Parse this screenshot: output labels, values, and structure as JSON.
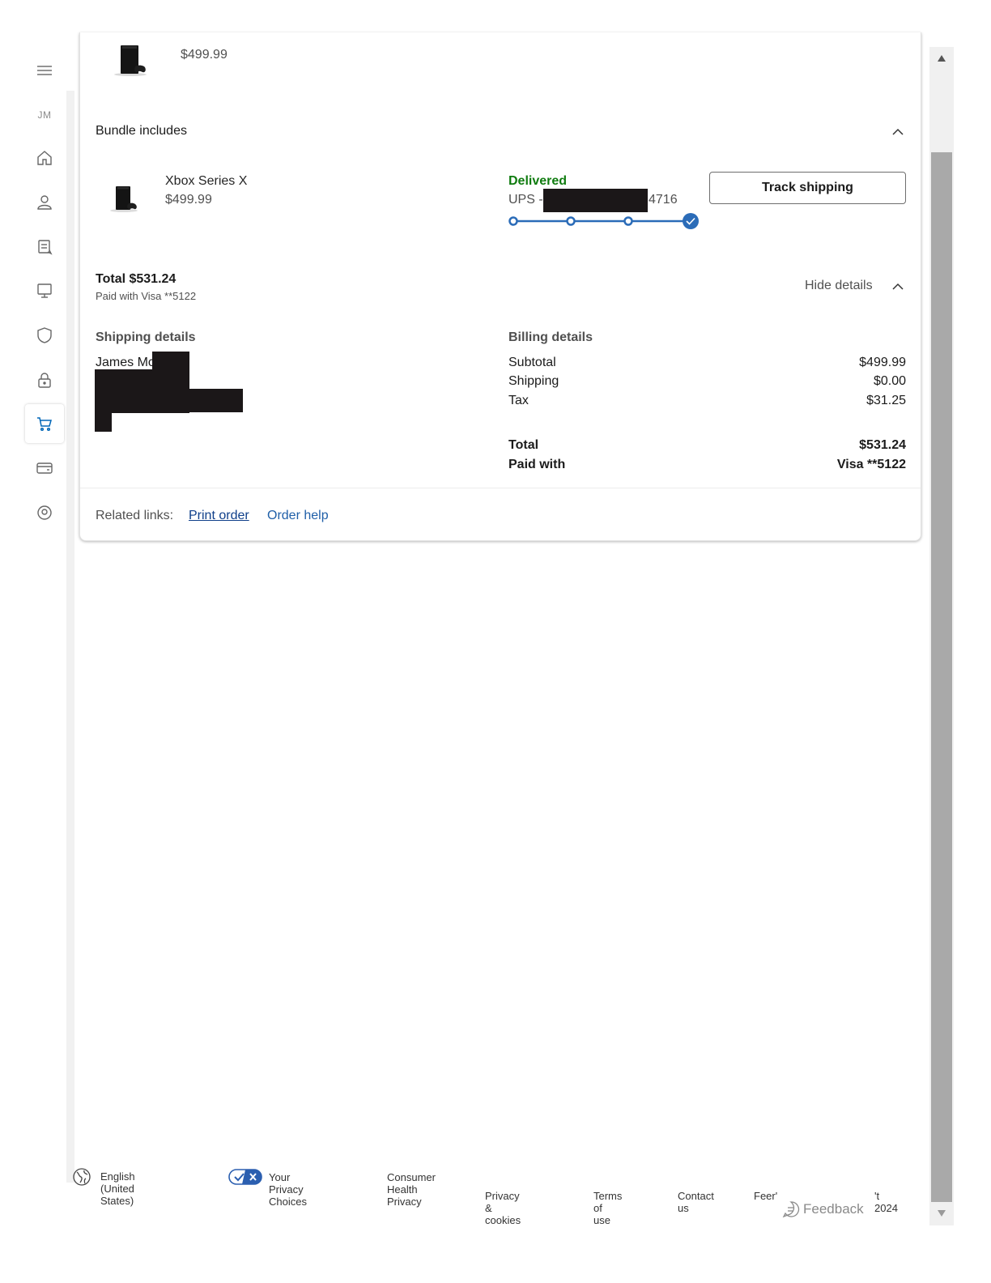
{
  "rail": {
    "menu_icon": "hamburger-icon",
    "initials": "JM",
    "items": [
      {
        "name": "home",
        "icon": "home-icon"
      },
      {
        "name": "profile",
        "icon": "person-icon"
      },
      {
        "name": "rewards",
        "icon": "document-icon"
      },
      {
        "name": "devices",
        "icon": "monitor-icon"
      },
      {
        "name": "security",
        "icon": "shield-icon"
      },
      {
        "name": "privacy",
        "icon": "lock-icon"
      },
      {
        "name": "orders",
        "icon": "cart-icon",
        "active": true
      },
      {
        "name": "payment",
        "icon": "card-icon"
      },
      {
        "name": "addresses",
        "icon": "location-icon"
      }
    ]
  },
  "order": {
    "top_item_price": "$499.99",
    "bundle_heading": "Bundle includes",
    "bundle_item": {
      "name": "Xbox Series X",
      "price": "$499.99",
      "status": "Delivered",
      "carrier_prefix": "UPS -",
      "tracking_suffix": "4716",
      "progress_steps": 4,
      "progress_completed": 4
    },
    "track_button": "Track shipping",
    "total_label": "Total $531.24",
    "paid_with_line": "Paid with Visa **5122",
    "hide_details": "Hide details"
  },
  "shipping": {
    "heading": "Shipping details",
    "name_visible": "James Mc"
  },
  "billing": {
    "heading": "Billing details",
    "rows": [
      {
        "label": "Subtotal",
        "value": "$499.99"
      },
      {
        "label": "Shipping",
        "value": "$0.00"
      },
      {
        "label": "Tax",
        "value": "$31.25"
      }
    ],
    "total_label": "Total",
    "total_value": "$531.24",
    "paid_label": "Paid with",
    "paid_value": "Visa **5122"
  },
  "related": {
    "label": "Related links:",
    "print_order": "Print order",
    "order_help": "Order help"
  },
  "footer": {
    "language": "English (United States)",
    "privacy_choices": "Your Privacy Choices",
    "consumer_health": "Consumer Health Privacy",
    "privacy_cookies": "Privacy & cookies",
    "terms": "Terms of use",
    "contact": "Contact us",
    "feed_partial": "Feer'",
    "copyright_partial": "'t 2024",
    "feedback": "Feedback"
  },
  "colors": {
    "delivered_green": "#107c10",
    "progress_blue": "#2b6cb8",
    "link_blue": "#1f5fa8"
  }
}
